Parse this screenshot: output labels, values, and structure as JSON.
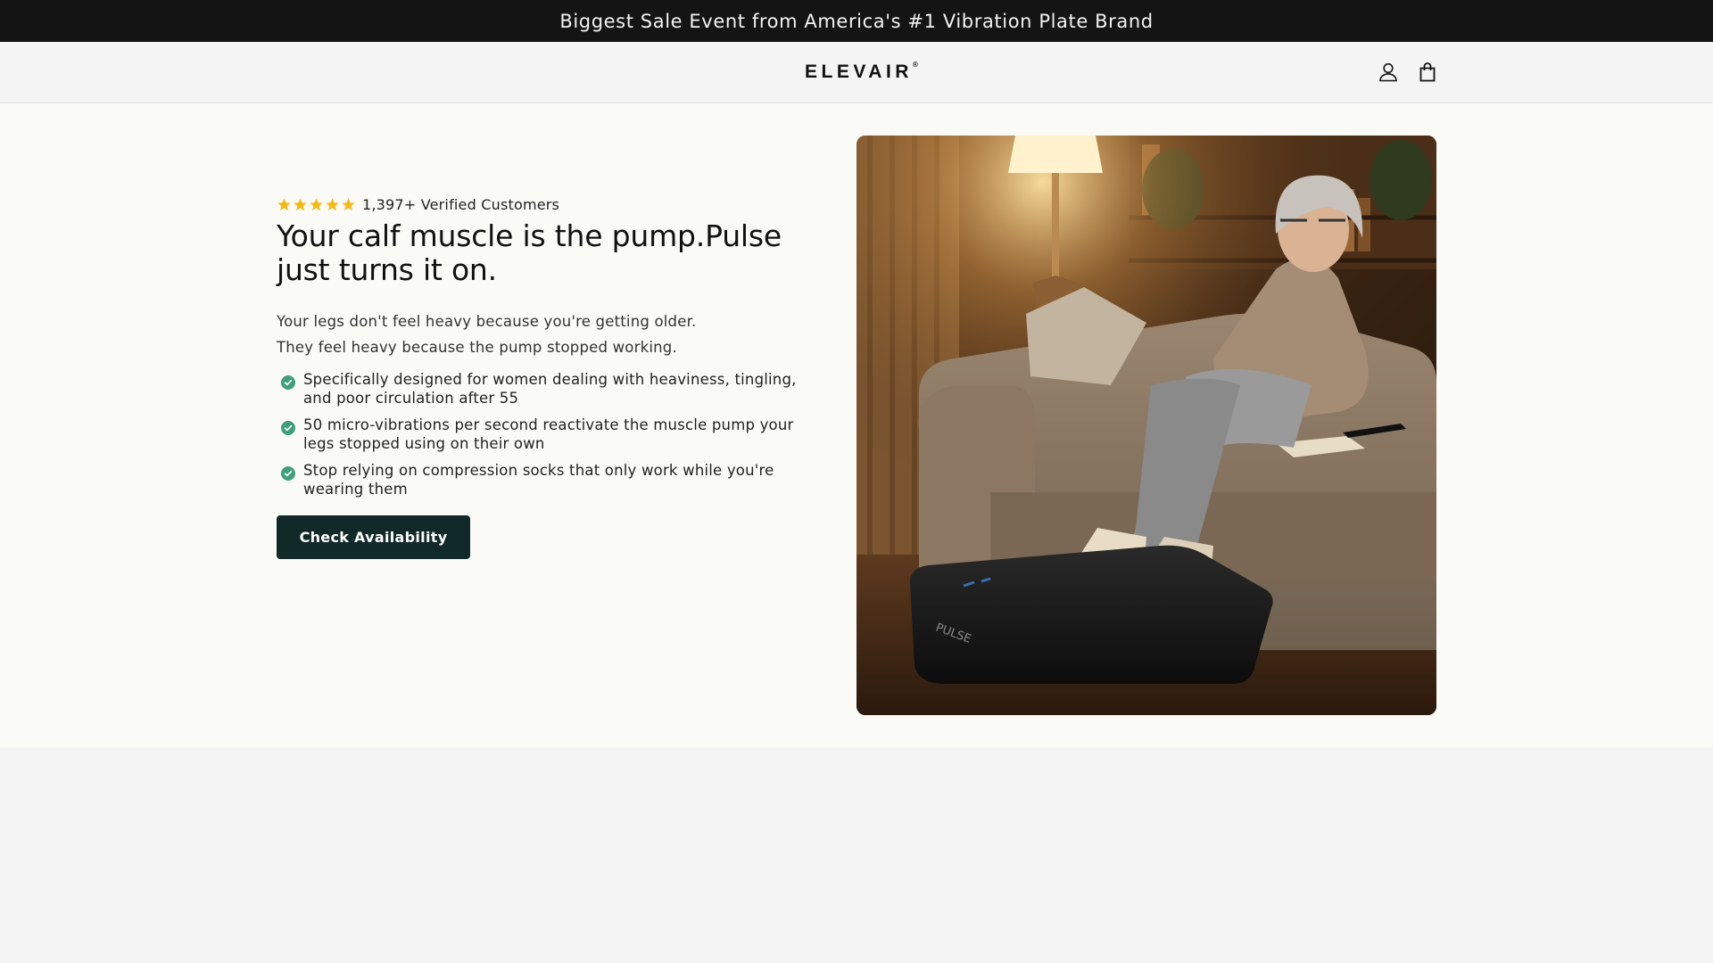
{
  "announcement": {
    "text": "Biggest Sale Event from America's #1 Vibration Plate Brand"
  },
  "header": {
    "logo_text": "ELEVAIR",
    "logo_mark": "®",
    "icons": [
      "account-icon",
      "cart-icon"
    ]
  },
  "hero": {
    "rating": {
      "stars": 5,
      "text": "1,397+ Verified Customers"
    },
    "title_line1": "Your calf muscle is the pump.Pulse",
    "title_line2": "just turns it on.",
    "subtitle_line1": "Your legs don't feel heavy because you're getting older.",
    "subtitle_line2": "They feel heavy because the pump stopped working.",
    "bullets": [
      {
        "line1": "Specifically designed for women dealing with heaviness, tingling,",
        "line2": "and poor circulation after 55"
      },
      {
        "line1": "50 micro-vibrations per second reactivate the muscle pump your",
        "line2": "legs stopped using on their own"
      },
      {
        "line1": "Stop relying on compression socks that only work while you're",
        "line2": "wearing them"
      }
    ],
    "cta_label": "Check Availability",
    "image": {
      "device_label": "PULSE"
    }
  },
  "colors": {
    "announcement_bg": "#141414",
    "cta_bg": "#12292a",
    "check_green": "#3f9f7b",
    "star_gold": "#f5b914",
    "hero_bg": "#fafaf6"
  }
}
